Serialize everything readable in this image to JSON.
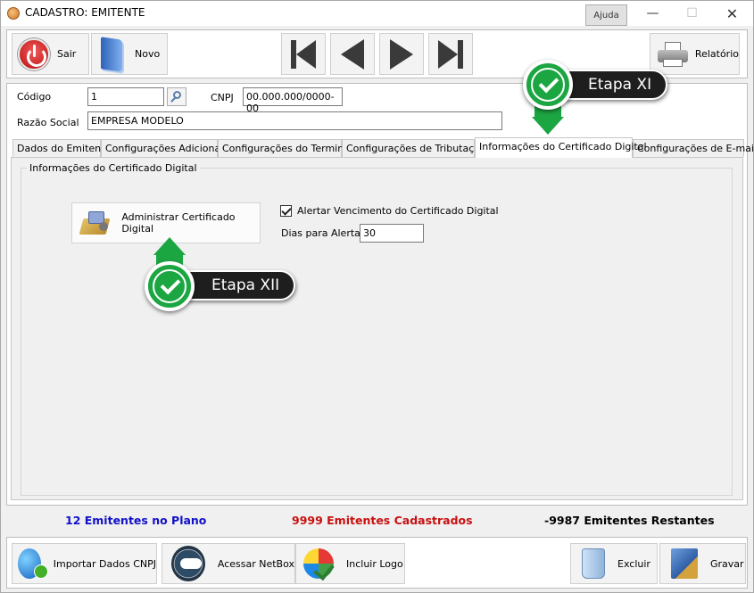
{
  "window": {
    "title": "CADASTRO: EMITENTE",
    "help_label": "Ajuda",
    "minimize": "—",
    "maximize": "☐",
    "close": "✕"
  },
  "toolbar": {
    "sair_label": "Sair",
    "novo_label": "Novo",
    "relatorio_label": "Relatório"
  },
  "form": {
    "codigo_label": "Código",
    "codigo_value": "1",
    "cnpj_label": "CNPJ",
    "cnpj_value": "00.000.000/0000-00",
    "razao_label": "Razão Social",
    "razao_value": "EMPRESA MODELO"
  },
  "tabs": [
    {
      "label": "Dados do Emitente"
    },
    {
      "label": "Configurações Adicionais"
    },
    {
      "label": "Configurações do Terminal"
    },
    {
      "label": "Configurações de Tributação"
    },
    {
      "label": "Informações do Certificado Digital",
      "active": true
    },
    {
      "label": "Configurações de E-mail"
    }
  ],
  "cert_panel": {
    "group_title": "Informações do Certificado Digital",
    "admin_button_label": "Administrar Certificado Digital",
    "alert_checkbox_label": "Alertar Vencimento do Certificado Digital",
    "alert_checked": true,
    "dias_label": "Dias para Alerta",
    "dias_value": "30"
  },
  "status": {
    "plano": "12 Emitentes no Plano",
    "cadastrados": "9999 Emitentes Cadastrados",
    "restantes": "-9987 Emitentes Restantes",
    "colors": {
      "plano": "#1010c8",
      "cadastrados": "#c81010",
      "restantes": "#000000"
    }
  },
  "bottombar": {
    "importar_label": "Importar Dados CNPJ",
    "netbox_label": "Acessar NetBox",
    "logo_label": "Incluir Logo",
    "excluir_label": "Excluir",
    "gravar_label": "Gravar"
  },
  "steps": {
    "step11": "Etapa XI",
    "step12": "Etapa XII",
    "accent": "#1ca642"
  }
}
